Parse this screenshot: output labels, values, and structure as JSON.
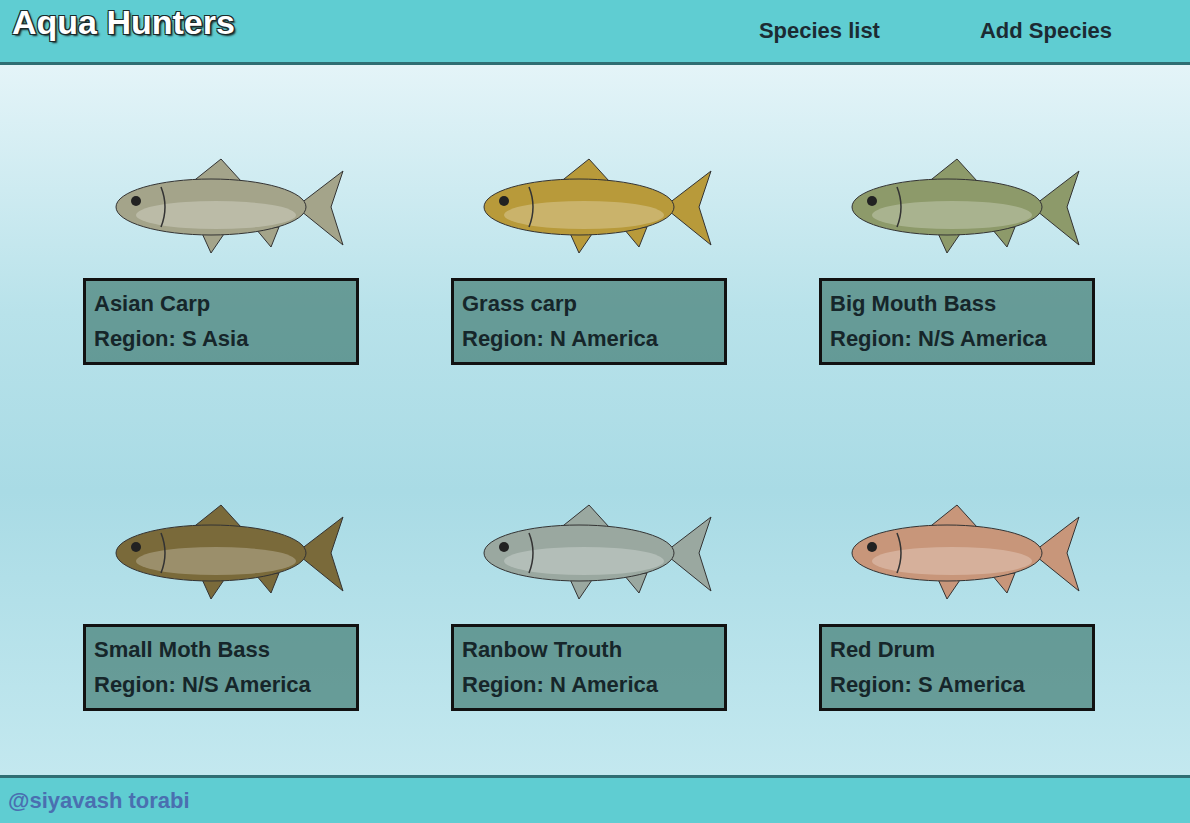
{
  "header": {
    "title": "Aqua Hunters",
    "nav": [
      "Species list",
      "Add Species"
    ]
  },
  "species": [
    {
      "name": "Asian Carp",
      "region": "Region: S Asia",
      "color": "#a4a48a"
    },
    {
      "name": "Grass carp",
      "region": "Region: N America",
      "color": "#b89a3a"
    },
    {
      "name": "Big Mouth Bass",
      "region": "Region: N/S America",
      "color": "#8d9a6a"
    },
    {
      "name": "Small Moth Bass",
      "region": "Region: N/S America",
      "color": "#7a6a3a"
    },
    {
      "name": "Ranbow Trouth",
      "region": "Region: N America",
      "color": "#9aa8a0"
    },
    {
      "name": "Red Drum",
      "region": "Region: S America",
      "color": "#c8967a"
    }
  ],
  "footer": {
    "credit": "@siyavash torabi"
  }
}
